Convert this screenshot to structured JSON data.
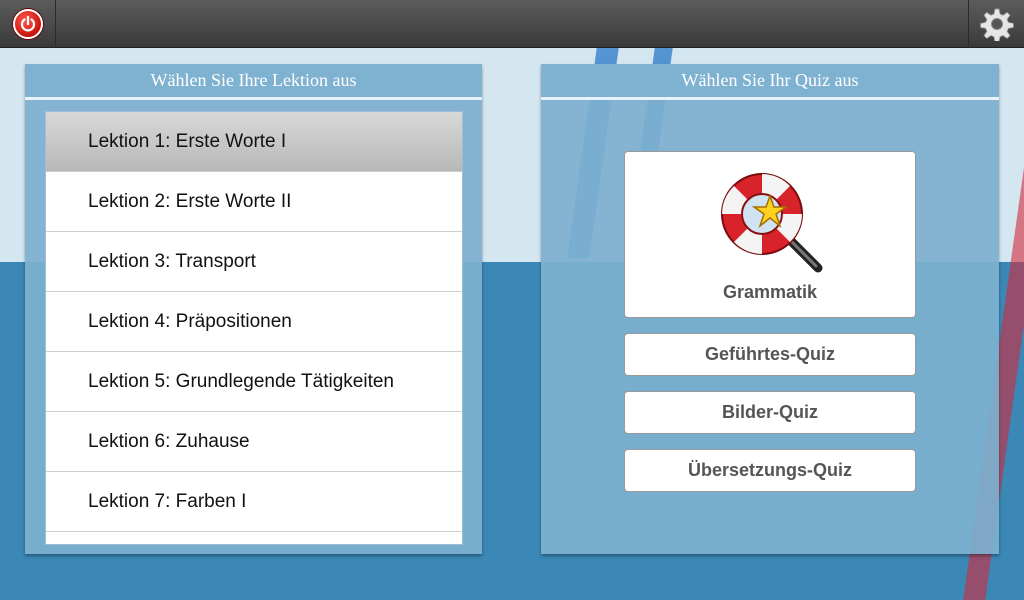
{
  "left_panel": {
    "title": "Wählen Sie Ihre Lektion aus",
    "lessons": [
      {
        "label": "Lektion 1: Erste Worte I",
        "selected": true
      },
      {
        "label": "Lektion 2: Erste Worte II",
        "selected": false
      },
      {
        "label": "Lektion 3: Transport",
        "selected": false
      },
      {
        "label": "Lektion 4: Präpositionen",
        "selected": false
      },
      {
        "label": "Lektion 5: Grundlegende Tätigkeiten",
        "selected": false
      },
      {
        "label": "Lektion 6: Zuhause",
        "selected": false
      },
      {
        "label": "Lektion 7: Farben I",
        "selected": false
      }
    ]
  },
  "right_panel": {
    "title": "Wählen Sie Ihr Quiz aus",
    "quizzes": {
      "grammar": "Grammatik",
      "guided": "Geführtes-Quiz",
      "picture": "Bilder-Quiz",
      "translation": "Übersetzungs-Quiz"
    }
  },
  "icons": {
    "power": "power-icon",
    "settings": "gear-icon",
    "grammar": "lifebuoy-magnifier-icon"
  },
  "colors": {
    "topbar": "#444444",
    "panel": "#7db0cf",
    "background": "#3b87b6",
    "selected_row": "#c4c4c4",
    "power": "#d8140b"
  }
}
